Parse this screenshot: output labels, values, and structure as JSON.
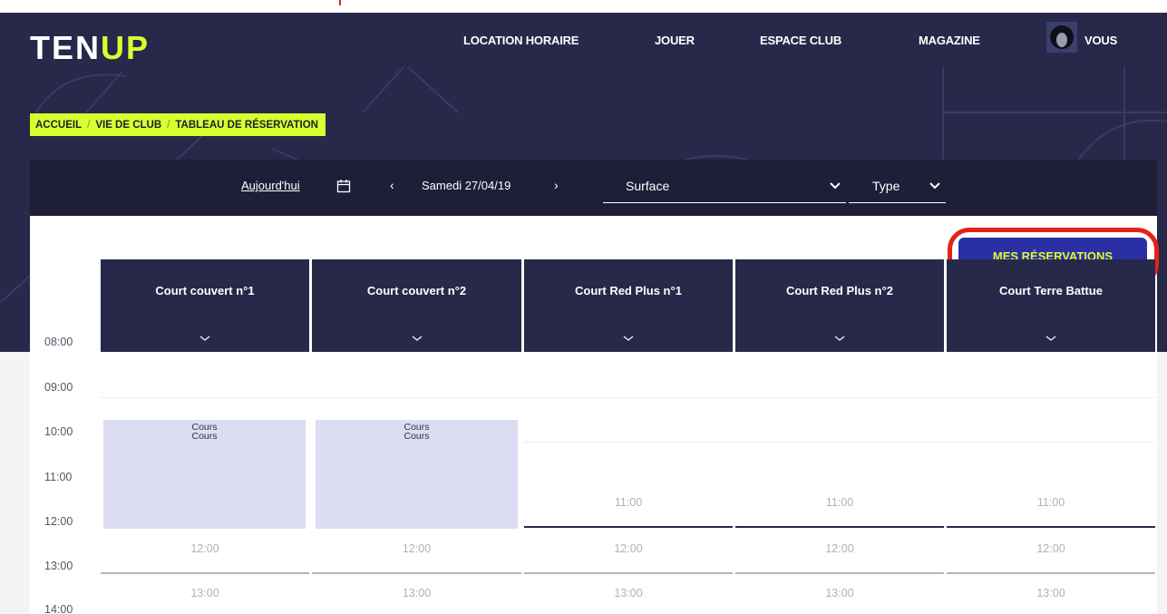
{
  "brand": {
    "logo_part1": "TEN",
    "logo_part2": "UP",
    "accent": "#d8ff2e"
  },
  "nav": {
    "items": [
      {
        "label": "LOCATION HORAIRE"
      },
      {
        "label": "JOUER"
      },
      {
        "label": "ESPACE CLUB"
      },
      {
        "label": "MAGAZINE"
      }
    ],
    "user_label": "VOUS",
    "avatar_icon": "user-avatar-icon"
  },
  "breadcrumb": [
    "ACCUEIL",
    "VIE DE CLUB",
    "TABLEAU DE RÉSERVATION"
  ],
  "filters": {
    "today_label": "Aujourd'hui",
    "calendar_icon": "calendar-icon",
    "prev_symbol": "‹",
    "next_symbol": "›",
    "date": "Samedi 27/04/19",
    "surface_label": "Surface",
    "type_label": "Type"
  },
  "mes_reservations_label": "MES RÉSERVATIONS",
  "courts": [
    {
      "name": "Court couvert n°1"
    },
    {
      "name": "Court couvert n°2"
    },
    {
      "name": "Court Red Plus n°1"
    },
    {
      "name": "Court Red Plus n°2"
    },
    {
      "name": "Court Terre Battue"
    }
  ],
  "times": [
    "08:00",
    "09:00",
    "10:00",
    "11:00",
    "12:00",
    "13:00",
    "14:00"
  ],
  "reservations": [
    {
      "court": 0,
      "line1": "Cours",
      "line2": "Cours"
    },
    {
      "court": 1,
      "line1": "Cours",
      "line2": "Cours"
    }
  ],
  "free_slots": {
    "row_1100": {
      "label": "11:00"
    },
    "row_1200": {
      "label": "12:00"
    },
    "row_1300": {
      "label": "13:00"
    }
  },
  "colors": {
    "navy": "#28284a",
    "button_blue": "#2b2fa6",
    "highlight_red": "#e2231a",
    "reservation_fill": "#dcdcf2"
  }
}
